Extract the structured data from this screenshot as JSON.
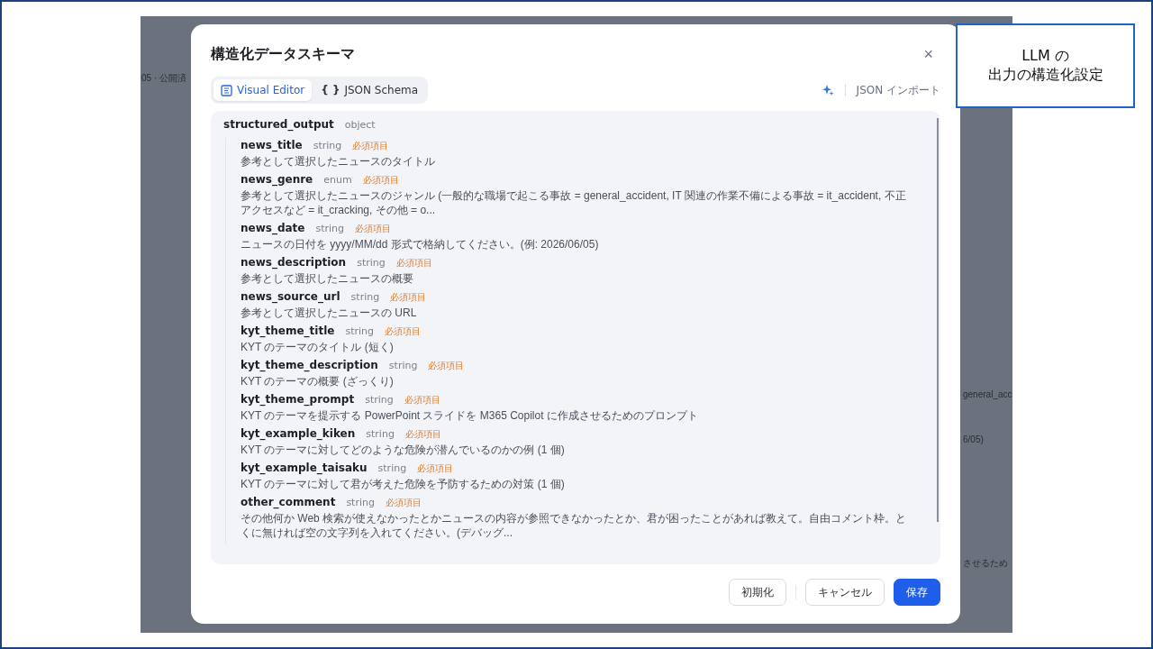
{
  "background": {
    "texts": [
      {
        "text": "05 · 公開済"
      },
      {
        "text": "general_acc"
      },
      {
        "text": "6/05)"
      },
      {
        "text": "させるため"
      }
    ]
  },
  "dialog": {
    "title": "構造化データスキーマ",
    "close": "×",
    "tabs": [
      {
        "label": "Visual Editor",
        "kind": "visual",
        "selected": true
      },
      {
        "label": "JSON Schema",
        "kind": "code",
        "glyph": "{ }",
        "selected": false
      }
    ],
    "import_button": "JSON インポート",
    "root": {
      "name": "structured_output",
      "type": "object"
    },
    "fields": [
      {
        "name": "news_title",
        "type": "string",
        "badge": "必須項目",
        "description": "参考として選択したニュースのタイトル"
      },
      {
        "name": "news_genre",
        "type": "enum",
        "badge": "必須項目",
        "description": "参考として選択したニュースのジャンル (一般的な職場で起こる事故 = general_accident, IT 関連の作業不備による事故 = it_accident, 不正アクセスなど = it_cracking, その他 = o..."
      },
      {
        "name": "news_date",
        "type": "string",
        "badge": "必須項目",
        "description": "ニュースの日付を yyyy/MM/dd 形式で格納してください。(例: 2026/06/05)"
      },
      {
        "name": "news_description",
        "type": "string",
        "badge": "必須項目",
        "description": "参考として選択したニュースの概要"
      },
      {
        "name": "news_source_url",
        "type": "string",
        "badge": "必須項目",
        "description": "参考として選択したニュースの URL"
      },
      {
        "name": "kyt_theme_title",
        "type": "string",
        "badge": "必須項目",
        "description": "KYT のテーマのタイトル (短く)"
      },
      {
        "name": "kyt_theme_description",
        "type": "string",
        "badge": "必須項目",
        "description": "KYT のテーマの概要 (ざっくり)"
      },
      {
        "name": "kyt_theme_prompt",
        "type": "string",
        "badge": "必須項目",
        "description": "KYT のテーマを提示する PowerPoint スライドを M365 Copilot に作成させるためのプロンプト"
      },
      {
        "name": "kyt_example_kiken",
        "type": "string",
        "badge": "必須項目",
        "description": "KYT のテーマに対してどのような危険が潜んでいるのかの例 (1 個)"
      },
      {
        "name": "kyt_example_taisaku",
        "type": "string",
        "badge": "必須項目",
        "description": "KYT のテーマに対して君が考えた危険を予防するための対策 (1 個)"
      },
      {
        "name": "other_comment",
        "type": "string",
        "badge": "必須項目",
        "description": "その他何か Web 検索が使えなかったとかニュースの内容が参照できなかったとか、君が困ったことがあれば教えて。自由コメント枠。とくに無ければ空の文字列を入れてください。(デバッグ..."
      }
    ],
    "buttons": [
      {
        "label": "初期化",
        "kind": "outline"
      },
      {
        "label": "キャンセル",
        "kind": "outline"
      },
      {
        "label": "保存",
        "kind": "primary"
      }
    ]
  },
  "callout": {
    "lines": [
      "LLM の",
      "出力の構造化設定"
    ]
  }
}
